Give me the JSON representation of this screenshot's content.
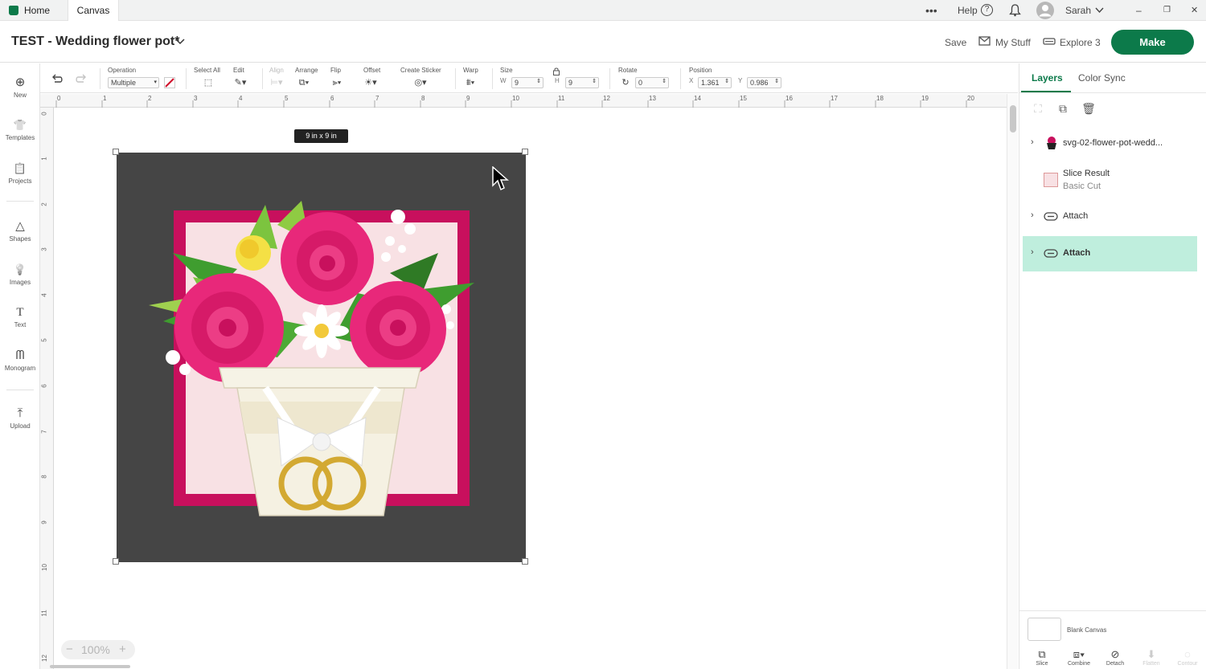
{
  "tabs": {
    "home": "Home",
    "canvas": "Canvas"
  },
  "topbar": {
    "more": "•••",
    "help": "Help",
    "help_icon": "?",
    "user": "Sarah",
    "window_min": "–",
    "window_restore": "❐",
    "window_close": "✕"
  },
  "header": {
    "title": "TEST - Wedding flower pot*",
    "save": "Save",
    "my_stuff": "My Stuff",
    "machine": "Explore 3",
    "make": "Make"
  },
  "toolbar": {
    "operation_label": "Operation",
    "operation_value": "Multiple",
    "select_all_label": "Select All",
    "edit_label": "Edit",
    "align_label": "Align",
    "arrange_label": "Arrange",
    "flip_label": "Flip",
    "offset_label": "Offset",
    "create_sticker_label": "Create Sticker",
    "warp_label": "Warp",
    "size_label": "Size",
    "w_label": "W",
    "w_value": "9",
    "h_label": "H",
    "h_value": "9",
    "rotate_label": "Rotate",
    "rotate_value": "0",
    "position_label": "Position",
    "x_label": "X",
    "x_value": "1.361",
    "y_label": "Y",
    "y_value": "0.986"
  },
  "leftnav": [
    {
      "label": "New",
      "icon": "⊕"
    },
    {
      "label": "Templates",
      "icon": "👕"
    },
    {
      "label": "Projects",
      "icon": "📋"
    },
    {
      "label": "Shapes",
      "icon": "△"
    },
    {
      "label": "Images",
      "icon": "💡"
    },
    {
      "label": "Text",
      "icon": "T"
    },
    {
      "label": "Monogram",
      "icon": "ᗰ"
    },
    {
      "label": "Upload",
      "icon": "⤒"
    }
  ],
  "rulers": {
    "top": [
      "0",
      "1",
      "2",
      "3",
      "4",
      "5",
      "6",
      "7",
      "8",
      "9",
      "10",
      "11",
      "12",
      "13",
      "14",
      "15",
      "16",
      "17",
      "18",
      "19",
      "20"
    ],
    "left": [
      "0",
      "1",
      "2",
      "3",
      "4",
      "5",
      "6",
      "7",
      "8",
      "9",
      "10",
      "11",
      "12"
    ]
  },
  "canvas": {
    "size_badge": "9 in x 9 in",
    "zoom": "100%",
    "zoom_minus": "−",
    "zoom_plus": "+"
  },
  "panel": {
    "tab_layers": "Layers",
    "tab_color_sync": "Color Sync",
    "layers": [
      {
        "name": "svg-02-flower-pot-wedd...",
        "sub": ""
      },
      {
        "name": "Slice Result",
        "sub": "Basic Cut"
      },
      {
        "name": "Attach",
        "sub": ""
      },
      {
        "name": "Attach",
        "sub": ""
      }
    ],
    "blank_canvas": "Blank Canvas",
    "bottom_buttons": [
      "Slice",
      "Combine",
      "Detach",
      "Flatten",
      "Contour"
    ]
  },
  "colors": {
    "accent": "#0c7a4a",
    "selected_layer": "#bfeedd",
    "art_bg": "#454545",
    "frame": "#c8105d",
    "frame_inner": "#f8e1e4",
    "rose": "#e8287a",
    "leaf": "#3f9d2f",
    "gold": "#d3a932"
  }
}
